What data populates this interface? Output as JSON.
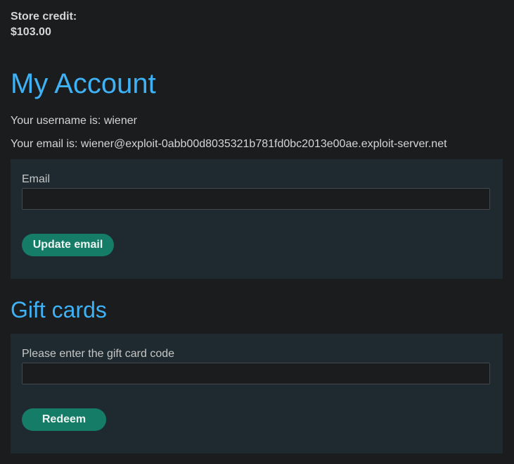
{
  "store_credit": {
    "label": "Store credit:",
    "amount": "$103.00"
  },
  "account": {
    "title": "My Account",
    "username_line": "Your username is: wiener",
    "email_line": "Your email is: wiener@exploit-0abb00d8035321b781fd0bc2013e00ae.exploit-server.net"
  },
  "email_form": {
    "label": "Email",
    "value": "",
    "button_label": "Update email"
  },
  "gift_cards": {
    "title": "Gift cards",
    "label": "Please enter the gift card code",
    "value": "",
    "button_label": "Redeem"
  },
  "colors": {
    "background": "#1b1c1e",
    "heading": "#3fb1f5",
    "panel": "#1e2a2f",
    "button": "#157c68"
  }
}
